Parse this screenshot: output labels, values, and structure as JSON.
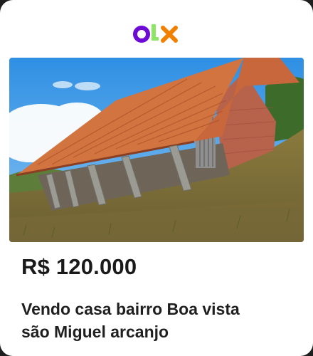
{
  "brand": {
    "logo_letters": [
      "o",
      "l",
      "x"
    ],
    "logo_colors": [
      "#6e0ad6",
      "#8ce563",
      "#f28000"
    ]
  },
  "listing": {
    "photo_icon": "house-photo",
    "price": "R$ 120.000",
    "title_lines": [
      "Vendo casa bairro Boa vista",
      "são Miguel arcanjo"
    ]
  },
  "colors": {
    "background": "#ffffff",
    "text": "#1a1a1a"
  }
}
